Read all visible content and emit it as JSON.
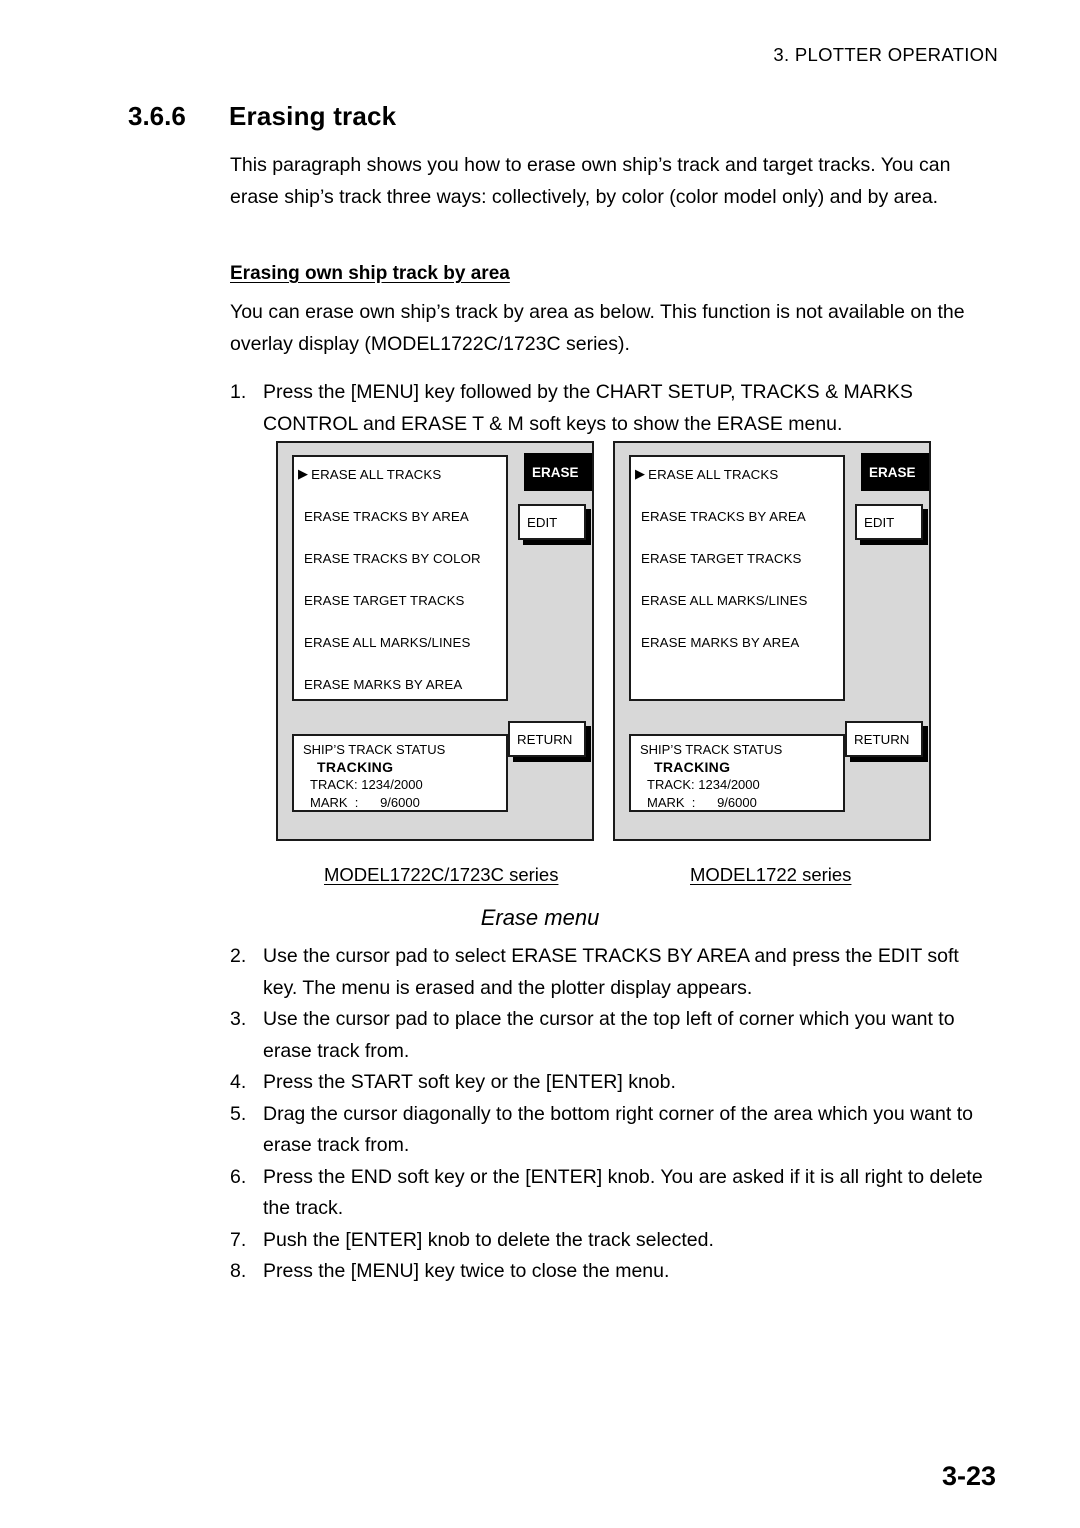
{
  "page": {
    "running_head": "3. PLOTTER OPERATION",
    "page_number": "3-23"
  },
  "section": {
    "number": "3.6.6",
    "title": "Erasing track",
    "intro": "This paragraph shows you how to erase own ship’s track and target tracks. You can erase ship’s track three ways: collectively, by color (color model only) and by area.",
    "sub_heading": "Erasing own ship track by area",
    "sub_intro": "You can erase own ship’s track by area as below. This function is not available on the overlay display (MODEL1722C/1723C series).",
    "step1": {
      "num": "1.",
      "text": "Press the [MENU] key followed by the CHART SETUP, TRACKS & MARKS CONTROL and ERASE T & M soft keys to show the ERASE menu."
    },
    "steps": [
      {
        "num": "2.",
        "text": "Use the cursor pad to select ERASE TRACKS BY AREA and press the EDIT soft key. The menu is erased and the plotter display appears."
      },
      {
        "num": "3.",
        "text": "Use the cursor pad to place the cursor at the top left of corner which you want to erase track from."
      },
      {
        "num": "4.",
        "text": "Press the START soft key or the [ENTER] knob."
      },
      {
        "num": "5.",
        "text": "Drag the cursor diagonally to the bottom right corner of the area which you want to erase track from."
      },
      {
        "num": "6.",
        "text": "Press the END soft key or the [ENTER] knob. You are asked if it is all right to delete the track."
      },
      {
        "num": "7.",
        "text": "Push the [ENTER] knob to delete the track selected."
      },
      {
        "num": "8.",
        "text": "Press the [MENU] key twice to close the menu."
      }
    ]
  },
  "figure": {
    "title": "Erase menu",
    "caption_left": "MODEL1722C/1723C series",
    "caption_right": "MODEL1722 series",
    "colors": {
      "panel_background": "#d8d8d8",
      "box_background": "#ffffff",
      "border": "#1a1a1a",
      "title_bar": "#000000",
      "title_text": "#ffffff"
    },
    "left_menu": {
      "title": "ERASE",
      "cursor": "▶",
      "items": [
        "ERASE ALL TRACKS",
        "ERASE TRACKS BY AREA",
        "ERASE TRACKS BY COLOR",
        "ERASE TARGET TRACKS",
        "ERASE ALL MARKS/LINES",
        "ERASE MARKS BY AREA"
      ],
      "softkeys": {
        "edit": "EDIT",
        "return": "RETURN"
      },
      "status": {
        "heading": "SHIP’S TRACK STATUS",
        "state": "TRACKING",
        "track": "TRACK: 1234/2000",
        "mark": "MARK  :      9/6000"
      }
    },
    "right_menu": {
      "title": "ERASE",
      "cursor": "▶",
      "items": [
        "ERASE ALL TRACKS",
        "ERASE TRACKS BY AREA",
        "ERASE TARGET TRACKS",
        "ERASE ALL MARKS/LINES",
        "ERASE MARKS BY AREA"
      ],
      "softkeys": {
        "edit": "EDIT",
        "return": "RETURN"
      },
      "status": {
        "heading": "SHIP’S TRACK STATUS",
        "state": "TRACKING",
        "track": "TRACK: 1234/2000",
        "mark": "MARK  :      9/6000"
      }
    }
  }
}
